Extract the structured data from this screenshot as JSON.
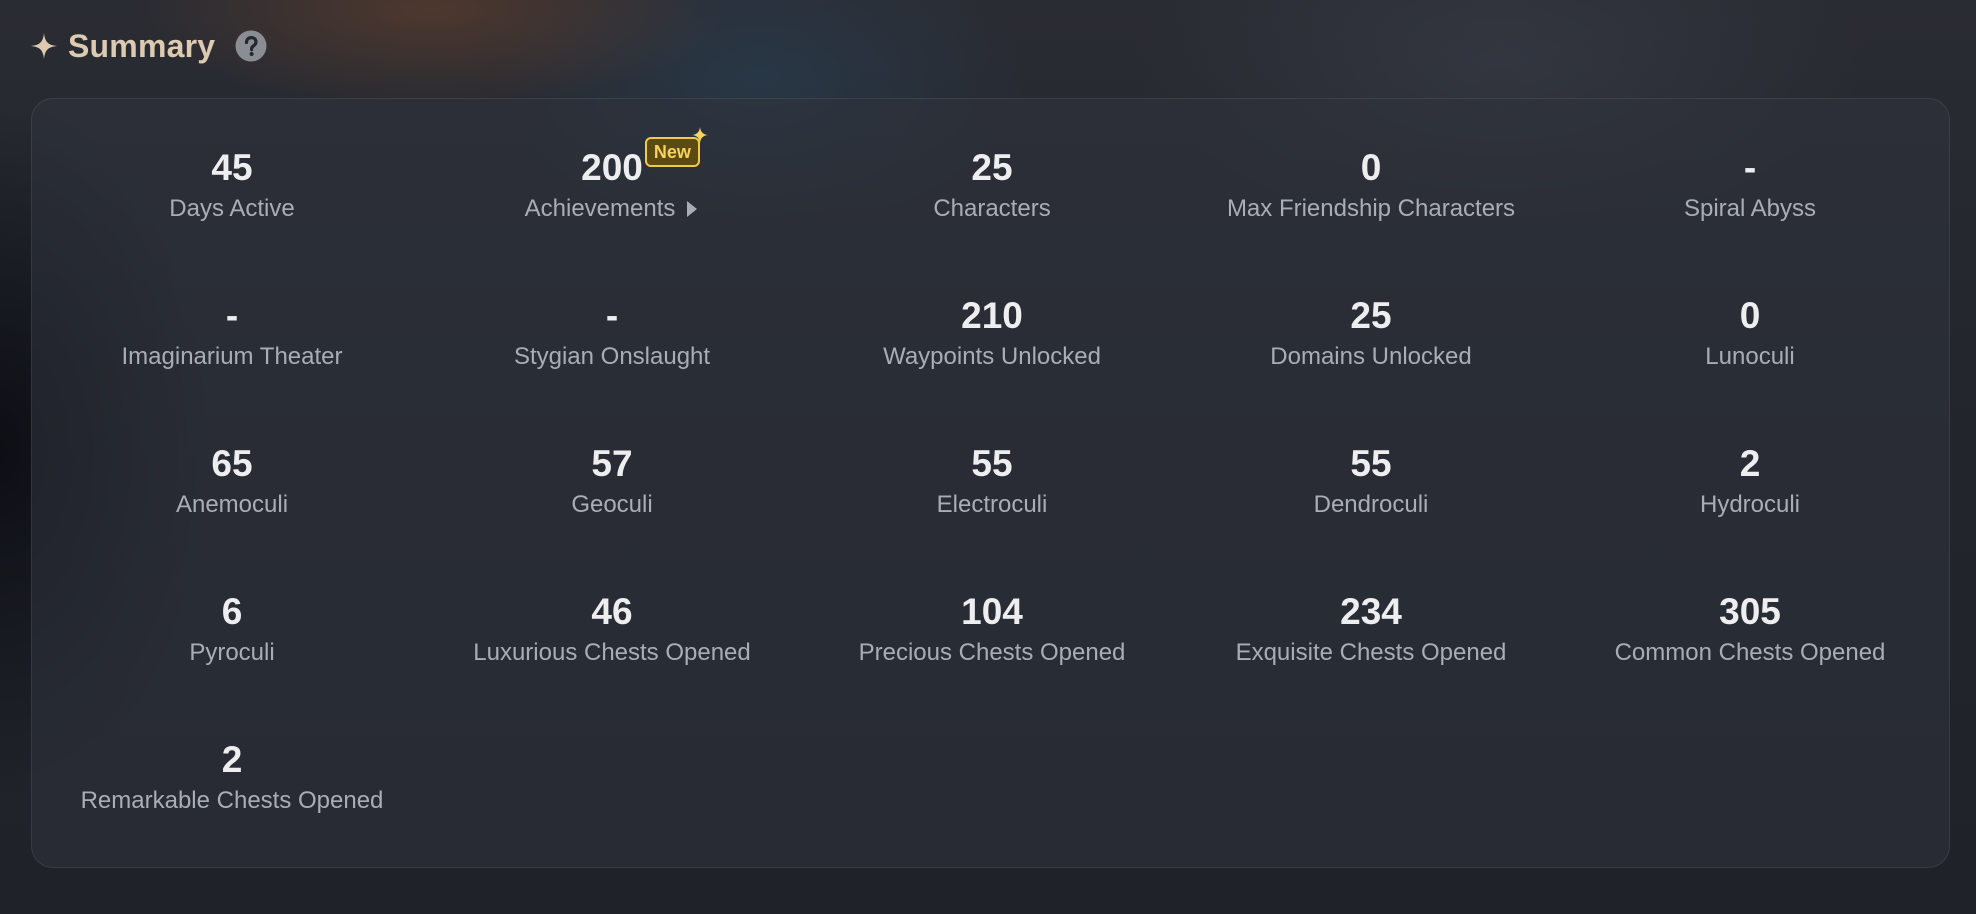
{
  "header": {
    "title": "Summary",
    "icon": "sparkle-icon",
    "help_icon": "question-circle-icon"
  },
  "colors": {
    "title": "#dccbb0",
    "value": "#eeeef0",
    "label": "#a9adb5",
    "badge_text": "#f6d25e",
    "badge_border": "#f1c94c"
  },
  "stats": [
    {
      "value": "45",
      "label": "Days Active"
    },
    {
      "value": "200",
      "label": "Achievements",
      "badge": "New"
    },
    {
      "value": "25",
      "label": "Characters"
    },
    {
      "value": "0",
      "label": "Max Friendship Characters"
    },
    {
      "value": "-",
      "label": "Spiral Abyss"
    },
    {
      "value": "-",
      "label": "Imaginarium Theater"
    },
    {
      "value": "-",
      "label": "Stygian Onslaught"
    },
    {
      "value": "210",
      "label": "Waypoints Unlocked"
    },
    {
      "value": "25",
      "label": "Domains Unlocked"
    },
    {
      "value": "0",
      "label": "Lunoculi"
    },
    {
      "value": "65",
      "label": "Anemoculi"
    },
    {
      "value": "57",
      "label": "Geoculi"
    },
    {
      "value": "55",
      "label": "Electroculi"
    },
    {
      "value": "55",
      "label": "Dendroculi"
    },
    {
      "value": "2",
      "label": "Hydroculi"
    },
    {
      "value": "6",
      "label": "Pyroculi"
    },
    {
      "value": "46",
      "label": "Luxurious Chests Opened"
    },
    {
      "value": "104",
      "label": "Precious Chests Opened"
    },
    {
      "value": "234",
      "label": "Exquisite Chests Opened"
    },
    {
      "value": "305",
      "label": "Common Chests Opened"
    },
    {
      "value": "2",
      "label": "Remarkable Chests Opened"
    }
  ]
}
